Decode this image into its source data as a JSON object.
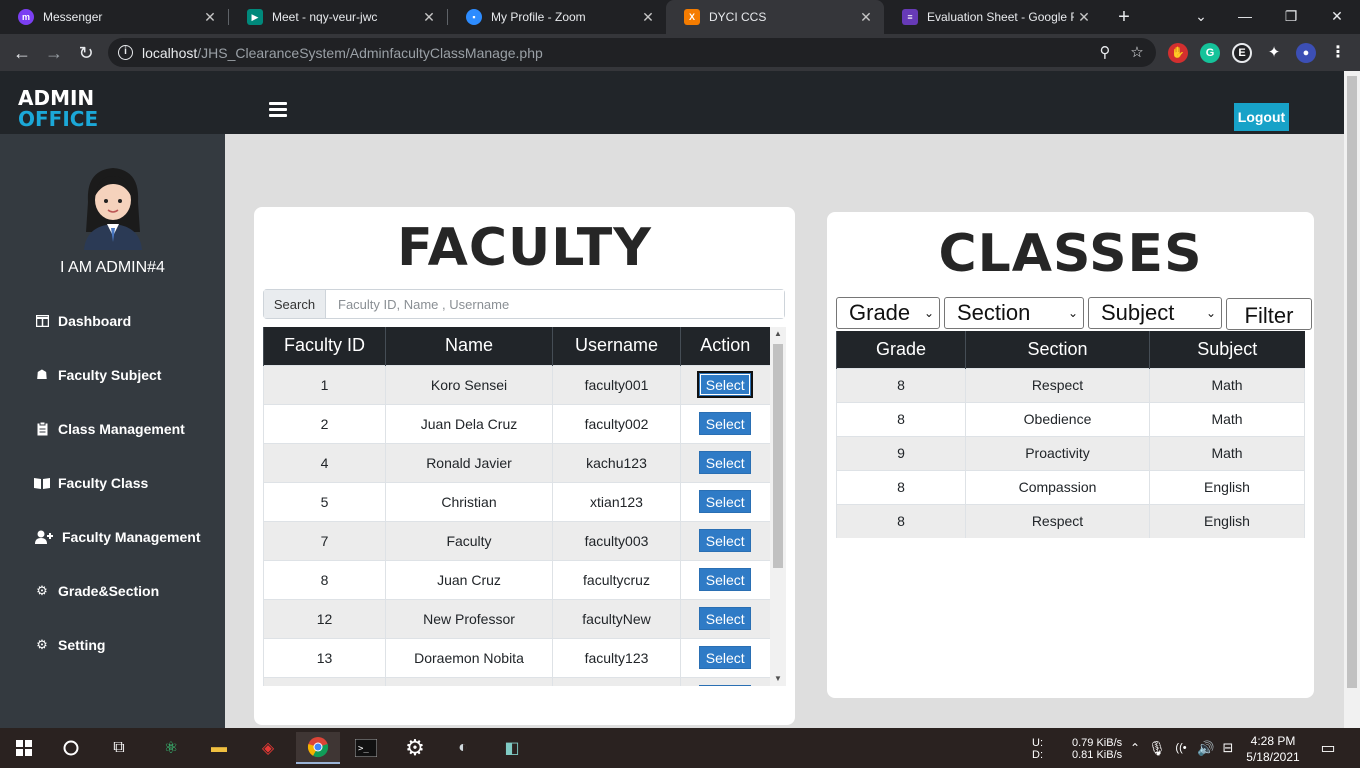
{
  "browser": {
    "tabs": [
      {
        "title": "Messenger",
        "icon_color": "#7b3ff2"
      },
      {
        "title": "Meet - nqy-veur-jwc",
        "icon_color": "#00897b"
      },
      {
        "title": "My Profile - Zoom",
        "icon_color": "#2d8cff"
      },
      {
        "title": "DYCI CCS",
        "icon_color": "#f57c00"
      },
      {
        "title": "Evaluation Sheet - Google Fo",
        "icon_color": "#673ab7"
      }
    ],
    "url_host": "localhost",
    "url_path": "/JHS_ClearanceSystem/AdminfacultyClassManage.php"
  },
  "header": {
    "brand_line1": "ADMIN",
    "brand_line2": "OFFICE",
    "logout_label": "Logout"
  },
  "sidebar": {
    "admin_name": "I AM ADMIN#4",
    "items": [
      {
        "label": "Dashboard",
        "icon": "columns-icon"
      },
      {
        "label": "Faculty Subject",
        "icon": "user-tie-icon"
      },
      {
        "label": "Class Management",
        "icon": "clipboard-icon"
      },
      {
        "label": "Faculty Class",
        "icon": "book-open-icon"
      },
      {
        "label": "Faculty Management",
        "icon": "user-plus-icon"
      },
      {
        "label": "Grade&Section",
        "icon": "gear-icon"
      },
      {
        "label": "Setting",
        "icon": "gear-icon"
      }
    ]
  },
  "faculty": {
    "title": "FACULTY",
    "search_label": "Search",
    "search_placeholder": "Faculty ID, Name , Username",
    "columns": [
      "Faculty ID",
      "Name",
      "Username",
      "Action"
    ],
    "select_label": "Select",
    "rows": [
      {
        "id": "1",
        "name": "Koro Sensei",
        "username": "faculty001"
      },
      {
        "id": "2",
        "name": "Juan Dela Cruz",
        "username": "faculty002"
      },
      {
        "id": "4",
        "name": "Ronald Javier",
        "username": "kachu123"
      },
      {
        "id": "5",
        "name": "Christian",
        "username": "xtian123"
      },
      {
        "id": "7",
        "name": "Faculty",
        "username": "faculty003"
      },
      {
        "id": "8",
        "name": "Juan Cruz",
        "username": "facultycruz"
      },
      {
        "id": "12",
        "name": "New Professor",
        "username": "facultyNew"
      },
      {
        "id": "13",
        "name": "Doraemon Nobita",
        "username": "faculty123"
      }
    ]
  },
  "classes": {
    "title": "CLASSES",
    "filters": {
      "grade": "Grade",
      "section": "Section",
      "subject": "Subject",
      "button": "Filter"
    },
    "columns": [
      "Grade",
      "Section",
      "Subject"
    ],
    "rows": [
      {
        "grade": "8",
        "section": "Respect",
        "subject": "Math"
      },
      {
        "grade": "8",
        "section": "Obedience",
        "subject": "Math"
      },
      {
        "grade": "9",
        "section": "Proactivity",
        "subject": "Math"
      },
      {
        "grade": "8",
        "section": "Compassion",
        "subject": "English"
      },
      {
        "grade": "8",
        "section": "Respect",
        "subject": "English"
      }
    ]
  },
  "taskbar": {
    "net_up_label": "U:",
    "net_down_label": "D:",
    "net_up": "0.79 KiB/s",
    "net_down": "0.81 KiB/s",
    "time": "4:28 PM",
    "date": "5/18/2021"
  }
}
